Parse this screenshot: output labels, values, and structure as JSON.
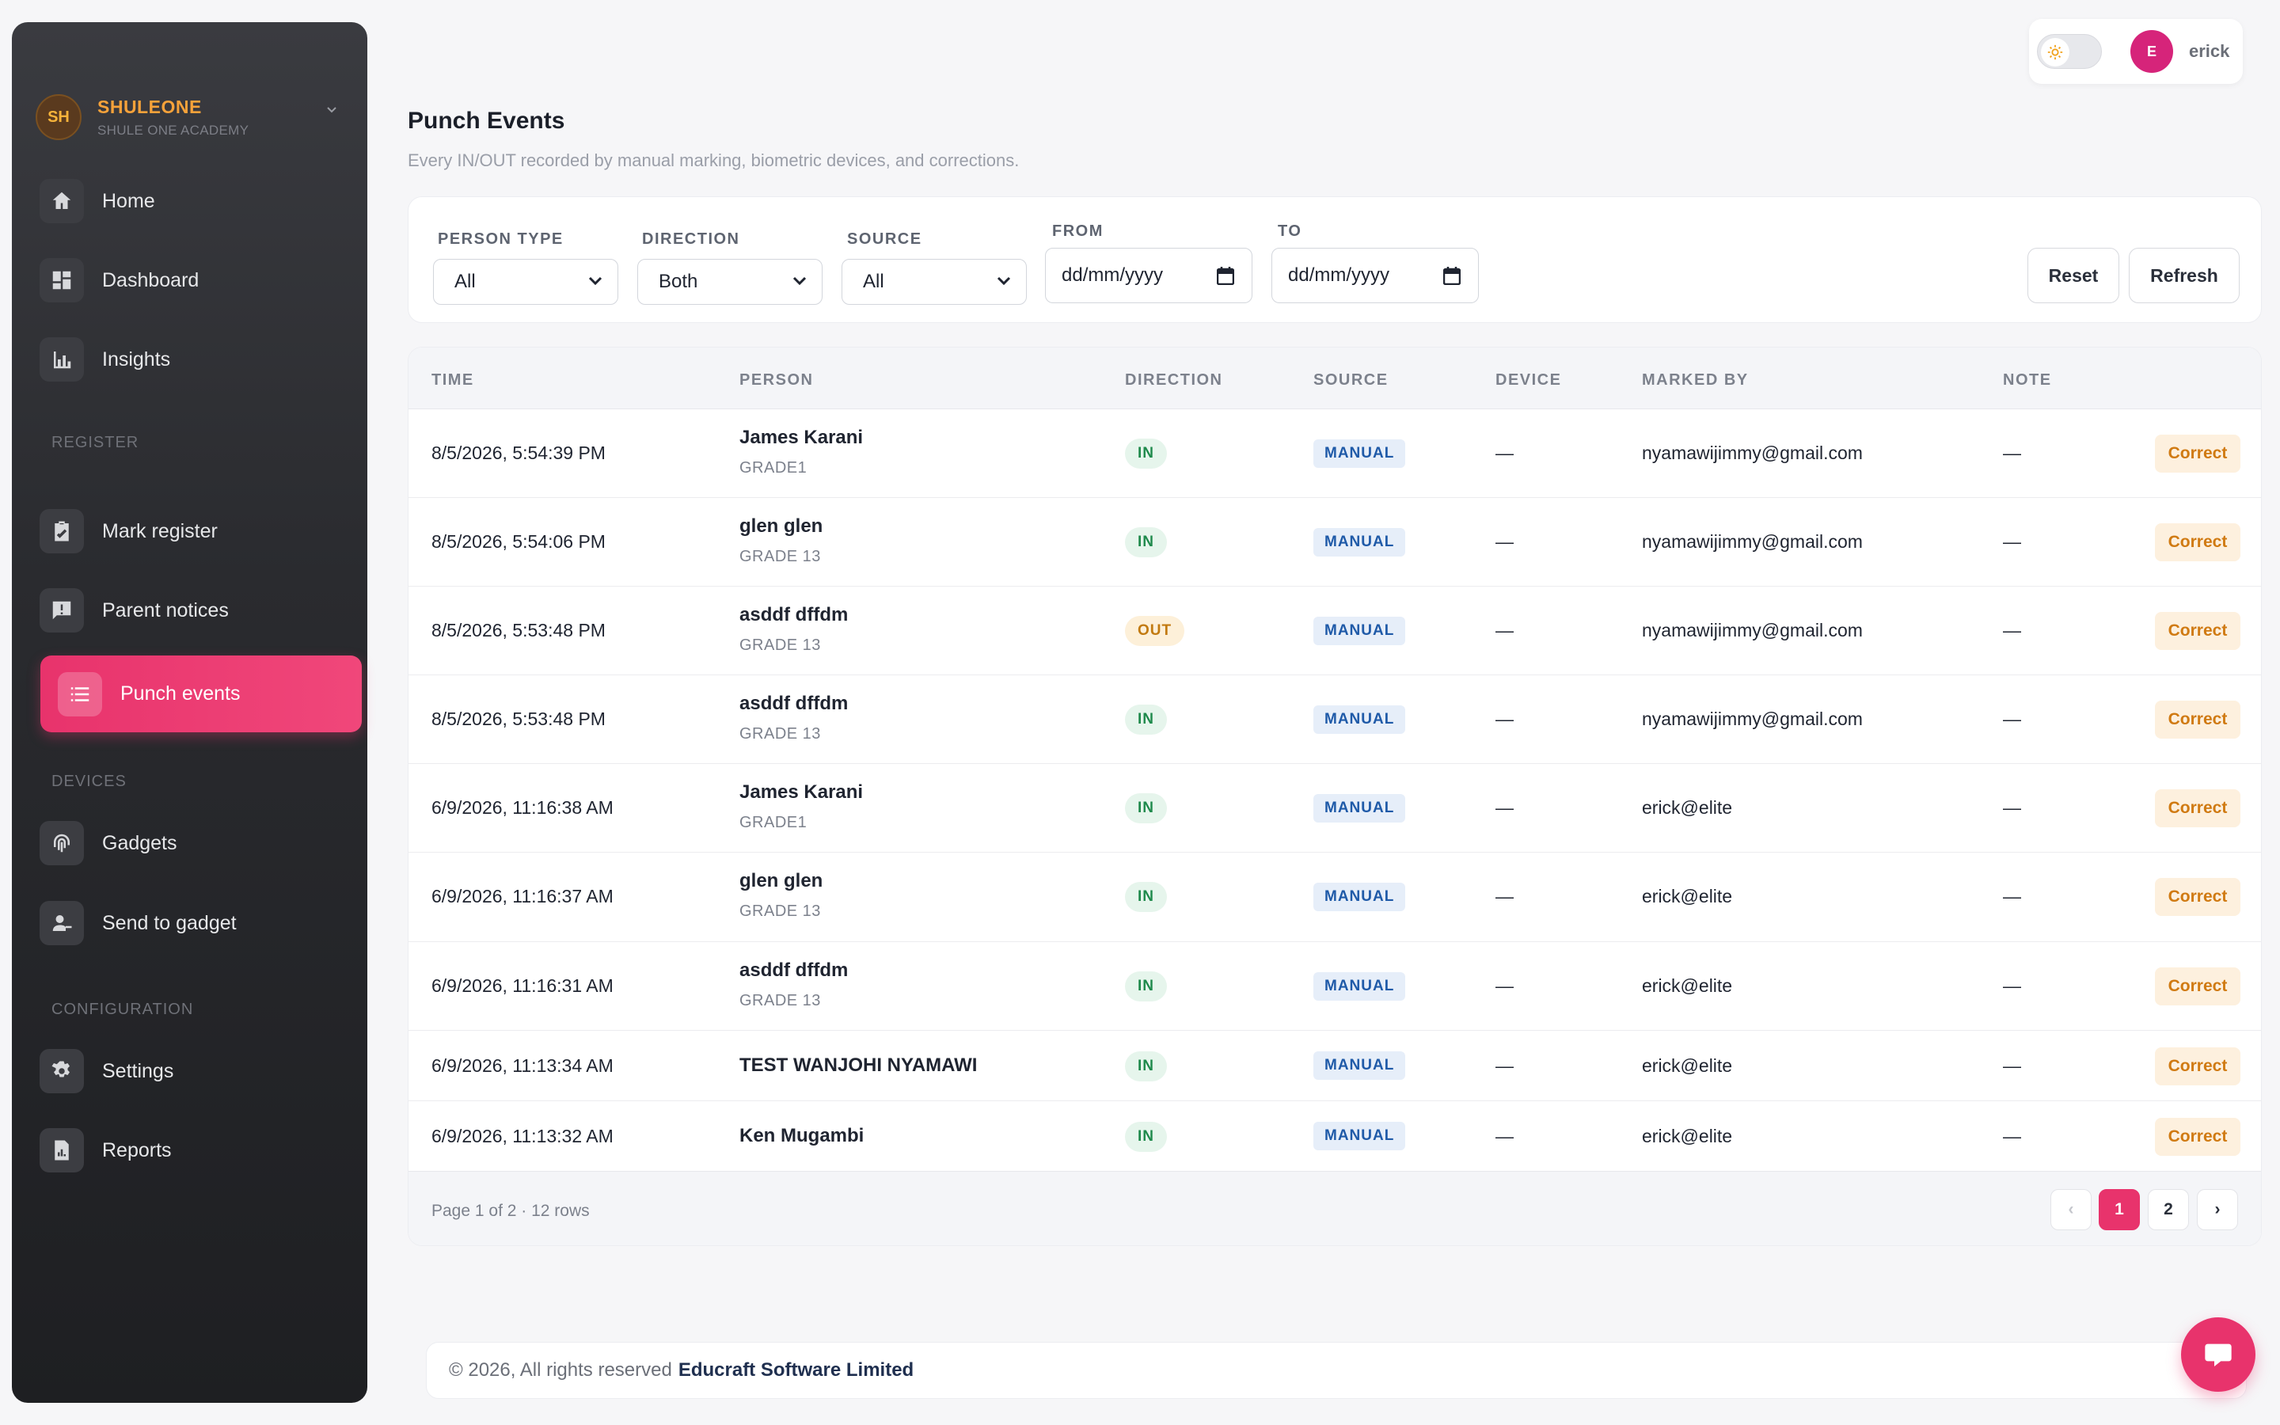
{
  "brand": {
    "initials": "SH",
    "name": "SHULEONE",
    "subtitle": "SHULE ONE ACADEMY"
  },
  "sidebar": {
    "items": [
      {
        "label": "Home",
        "icon": "home-icon"
      },
      {
        "label": "Dashboard",
        "icon": "dashboard-icon"
      },
      {
        "label": "Insights",
        "icon": "bar-chart-icon"
      },
      {
        "label": "Mark register",
        "icon": "clipboard-check-icon"
      },
      {
        "label": "Parent notices",
        "icon": "notice-icon"
      },
      {
        "label": "Punch events",
        "icon": "list-icon",
        "active": true
      },
      {
        "label": "Gadgets",
        "icon": "fingerprint-icon"
      },
      {
        "label": "Send to gadget",
        "icon": "user-send-icon"
      },
      {
        "label": "Settings",
        "icon": "gear-icon"
      },
      {
        "label": "Reports",
        "icon": "report-icon"
      }
    ],
    "sections": {
      "register": "REGISTER",
      "devices": "DEVICES",
      "configuration": "CONFIGURATION"
    }
  },
  "user": {
    "initial": "E",
    "name": "erick"
  },
  "page": {
    "title": "Punch Events",
    "subtitle": "Every IN/OUT recorded by manual marking, biometric devices, and corrections."
  },
  "filters": {
    "person_type": {
      "label": "PERSON TYPE",
      "value": "All"
    },
    "direction": {
      "label": "DIRECTION",
      "value": "Both"
    },
    "source": {
      "label": "SOURCE",
      "value": "All"
    },
    "from": {
      "label": "FROM",
      "value": "dd/mm/yyyy"
    },
    "to": {
      "label": "TO",
      "value": "dd/mm/yyyy"
    },
    "reset_label": "Reset",
    "refresh_label": "Refresh"
  },
  "table": {
    "headers": [
      "TIME",
      "PERSON",
      "DIRECTION",
      "SOURCE",
      "DEVICE",
      "MARKED BY",
      "NOTE"
    ],
    "action_label": "Correct",
    "rows": [
      {
        "time": "8/5/2026, 5:54:39 PM",
        "name": "James Karani",
        "grade": "GRADE1",
        "direction": "IN",
        "source": "MANUAL",
        "device": "—",
        "marked_by": "nyamawijimmy@gmail.com",
        "note": "—"
      },
      {
        "time": "8/5/2026, 5:54:06 PM",
        "name": "glen glen",
        "grade": "GRADE 13",
        "direction": "IN",
        "source": "MANUAL",
        "device": "—",
        "marked_by": "nyamawijimmy@gmail.com",
        "note": "—"
      },
      {
        "time": "8/5/2026, 5:53:48 PM",
        "name": "asddf dffdm",
        "grade": "GRADE 13",
        "direction": "OUT",
        "source": "MANUAL",
        "device": "—",
        "marked_by": "nyamawijimmy@gmail.com",
        "note": "—"
      },
      {
        "time": "8/5/2026, 5:53:48 PM",
        "name": "asddf dffdm",
        "grade": "GRADE 13",
        "direction": "IN",
        "source": "MANUAL",
        "device": "—",
        "marked_by": "nyamawijimmy@gmail.com",
        "note": "—"
      },
      {
        "time": "6/9/2026, 11:16:38 AM",
        "name": "James Karani",
        "grade": "GRADE1",
        "direction": "IN",
        "source": "MANUAL",
        "device": "—",
        "marked_by": "erick@elite",
        "note": "—"
      },
      {
        "time": "6/9/2026, 11:16:37 AM",
        "name": "glen glen",
        "grade": "GRADE 13",
        "direction": "IN",
        "source": "MANUAL",
        "device": "—",
        "marked_by": "erick@elite",
        "note": "—"
      },
      {
        "time": "6/9/2026, 11:16:31 AM",
        "name": "asddf dffdm",
        "grade": "GRADE 13",
        "direction": "IN",
        "source": "MANUAL",
        "device": "—",
        "marked_by": "erick@elite",
        "note": "—"
      },
      {
        "time": "6/9/2026, 11:13:34 AM",
        "name": "TEST WANJOHI NYAMAWI",
        "grade": "",
        "direction": "IN",
        "source": "MANUAL",
        "device": "—",
        "marked_by": "erick@elite",
        "note": "—"
      },
      {
        "time": "6/9/2026, 11:13:32 AM",
        "name": "Ken Mugambi",
        "grade": "",
        "direction": "IN",
        "source": "MANUAL",
        "device": "—",
        "marked_by": "erick@elite",
        "note": "—"
      }
    ]
  },
  "pagination": {
    "info": "Page 1 of 2 · 12 rows",
    "prev": "‹",
    "pages": [
      "1",
      "2"
    ],
    "next": "›",
    "current": "1"
  },
  "footer": {
    "text": "© 2026, All rights reserved",
    "company": "Educraft Software Limited"
  },
  "colors": {
    "accent": "#e8336c",
    "brand": "#f6a23a",
    "in_pill": "#1f8a4c",
    "out_pill": "#c27a10",
    "source_tag": "#1f5aa8"
  }
}
